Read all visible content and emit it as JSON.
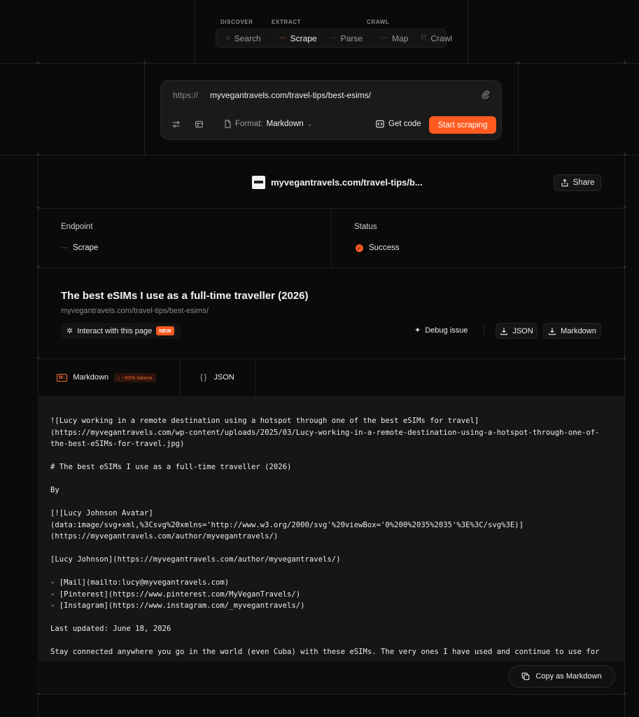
{
  "nav": {
    "groups": {
      "discover": "DISCOVER",
      "extract": "EXTRACT",
      "crawl": "CRAWL"
    },
    "items": [
      {
        "label": "Search",
        "icon": "search-icon"
      },
      {
        "label": "Scrape",
        "icon": "scrape-icon",
        "active": true
      },
      {
        "label": "Parse",
        "icon": "parse-icon"
      },
      {
        "label": "Map",
        "icon": "map-icon"
      },
      {
        "label": "Crawl",
        "icon": "crawl-icon"
      }
    ]
  },
  "url_bar": {
    "prefix": "https://",
    "value": "myvegantravels.com/travel-tips/best-esims/",
    "format_label": "Format:",
    "format_value": "Markdown",
    "get_code": "Get code",
    "start": "Start scraping"
  },
  "result": {
    "page_url": "myvegantravels.com/travel-tips/b...",
    "share": "Share",
    "endpoint_label": "Endpoint",
    "endpoint_value": "Scrape",
    "status_label": "Status",
    "status_value": "Success",
    "title": "The best eSIMs I use as a full-time traveller (2026)",
    "subtitle": "myvegantravels.com/travel-tips/best-esims/",
    "interact": "Interact with this page",
    "new_badge": "NEW",
    "debug": "Debug issue",
    "json_btn": "JSON",
    "markdown_btn": "Markdown"
  },
  "tabs": {
    "markdown": "Markdown",
    "tokens": "↓ ~93% tokens",
    "json": "JSON"
  },
  "code": "![Lucy working in a remote destination using a hotspot through one of the best eSIMs for travel]\n(https://myvegantravels.com/wp-content/uploads/2025/03/Lucy-working-in-a-remote-destination-using-a-hotspot-through-one-of-\nthe-best-eSIMs-for-travel.jpg)\n\n# The best eSIMs I use as a full-time traveller (2026)\n\nBy\n\n[![Lucy Johnson Avatar]\n(data:image/svg+xml,%3Csvg%20xmlns='http://www.w3.org/2000/svg'%20viewBox='0%200%2035%2035'%3E%3C/svg%3E)]\n(https://myvegantravels.com/author/myvegantravels/)\n\n[Lucy Johnson](https://myvegantravels.com/author/myvegantravels/)\n\n- [Mail](mailto:lucy@myvegantravels.com)\n- [Pinterest](https://www.pinterest.com/MyVeganTravels/)\n- [Instagram](https://www.instagram.com/_myvegantravels/)\n\nLast updated: June 18, 2026\n\nStay connected anywhere you go in the world (even Cuba) with these eSIMs. The very ones I have used and continue to use for",
  "copy_button": "Copy as Markdown"
}
